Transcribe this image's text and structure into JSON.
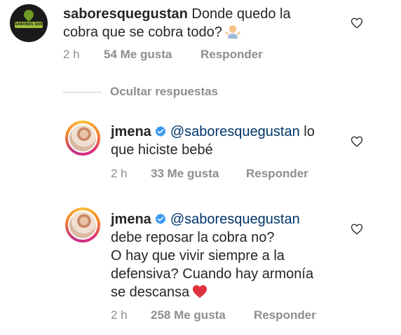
{
  "comment": {
    "username": "saboresquegustan",
    "text_line1": "Donde quedo la",
    "text_line2": "cobra que se cobra todo?",
    "emoji": "person-shrugging-emoji",
    "time": "2 h",
    "likes": "54 Me gusta",
    "reply_label": "Responder",
    "avatar_logo_text": "SABORES QUE GUSTAN"
  },
  "hide_replies_label": "Ocultar respuestas",
  "replies": [
    {
      "username": "jmena",
      "verified": true,
      "mention": "@saboresquegustan",
      "text_line1_tail": "lo",
      "text_line2": "que hiciste bebé",
      "time": "2 h",
      "likes": "33 Me gusta",
      "reply_label": "Responder"
    },
    {
      "username": "jmena",
      "verified": true,
      "mention": "@saboresquegustan",
      "text_line2": "debe reposar la cobra no?",
      "text_line3": "O hay que vivir siempre a la",
      "text_line4": "defensiva? Cuando hay armonía",
      "text_line5": "se descansa",
      "emoji": "red-heart-emoji",
      "time": "2 h",
      "likes": "258 Me gusta",
      "reply_label": "Responder"
    }
  ],
  "colors": {
    "text": "#262626",
    "muted": "#8e8e8e",
    "mention": "#003569",
    "verified": "#3897f0",
    "heart_red": "#ed4956"
  }
}
